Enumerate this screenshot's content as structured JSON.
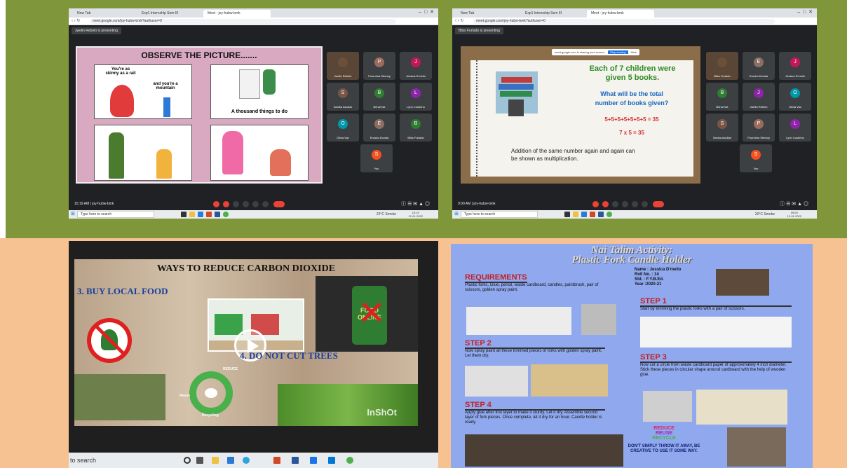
{
  "screen1": {
    "tabs": [
      "New Tab",
      "Exp1 Internship Sem III",
      "Meet - joy-hubw-bmk"
    ],
    "url": "meet.google.com/joy-hubw-bmk?authuser=0",
    "presenting": "Jwelin Rebelo is presenting",
    "slide_title": "OBSERVE THE PICTURE.......",
    "cell1_text_a": "You're as skinny as a rail",
    "cell1_text_b": "and you're a mountain",
    "cell2_text": "A thousand things to do",
    "participants": [
      {
        "name": "Jwelin Rebelo",
        "initial": "",
        "color": "#6a4f3a"
      },
      {
        "name": "Poornima Shenoy",
        "initial": "P",
        "color": "#9c6b5c"
      },
      {
        "name": "Jessica D'mello",
        "initial": "J",
        "color": "#c2185b"
      },
      {
        "name": "Sanika Asolkar",
        "initial": "S",
        "color": "#795548"
      },
      {
        "name": "Brinal NA",
        "initial": "B",
        "color": "#2e7d32"
      },
      {
        "name": "Lynn Coutinho",
        "initial": "L",
        "color": "#8e24aa"
      },
      {
        "name": "Olivia Vaz",
        "initial": "O",
        "color": "#0097a7"
      },
      {
        "name": "Erusha Dcosta",
        "initial": "E",
        "color": "#8d6e63"
      },
      {
        "name": "Bliss Furtado",
        "initial": "B",
        "color": "#2e7d32"
      },
      {
        "name": "You",
        "initial": "S",
        "color": "#f4511e"
      }
    ],
    "meeting_info": "10:19 AM | joy-hubw-bmk",
    "taskbar_search": "Type here to search",
    "weather": "22°C Smoke",
    "clock_time": "10:19",
    "clock_date": "12-01-2022"
  },
  "screen2": {
    "tabs": [
      "New Tab",
      "Exp1 Internship Sem III",
      "Meet - joy-hubw-bmk"
    ],
    "url": "meet.google.com/joy-hubw-bmk?authuser=0",
    "presenting": "Bliss Furtado is presenting",
    "banner_text": "meet.google.com is sharing your screen",
    "banner_btn1": "Stop sharing",
    "banner_btn2": "Hide",
    "line1": "Each of 7 children were",
    "line2": "given 5 books.",
    "question1": "What will be the total",
    "question2": "number of books given?",
    "sum": "5+5+5+5+5+5+5 = 35",
    "product": "7 x 5 = 35",
    "footer1": "Addition of the same number again and again can",
    "footer2": "be shown as multiplication.",
    "participants": [
      {
        "name": "Bliss Furtado",
        "initial": "",
        "color": "#6a4f3a"
      },
      {
        "name": "Erusha Dcosta",
        "initial": "E",
        "color": "#8d6e63"
      },
      {
        "name": "Jessica D'mello",
        "initial": "J",
        "color": "#c2185b"
      },
      {
        "name": "Brinal NA",
        "initial": "B",
        "color": "#2e7d32"
      },
      {
        "name": "Jwelin Rebelo",
        "initial": "J",
        "color": "#8e24aa"
      },
      {
        "name": "Olivia Vaz",
        "initial": "O",
        "color": "#0097a7"
      },
      {
        "name": "Sanika Asolkar",
        "initial": "S",
        "color": "#795548"
      },
      {
        "name": "Poornima Shenoy",
        "initial": "P",
        "color": "#9c6b5c"
      },
      {
        "name": "Lynn Coutinho",
        "initial": "L",
        "color": "#8e24aa"
      },
      {
        "name": "You",
        "initial": "S",
        "color": "#f4511e"
      }
    ],
    "meeting_info": "9:00 AM | joy-hubw-bmk",
    "taskbar_search": "Type here to search",
    "weather": "20°C Smoke",
    "clock_time": "09:00",
    "clock_date": "12-01-2022"
  },
  "screen3": {
    "title": "WAYS TO REDUCE CARBON DIOXIDE",
    "point3": "3. BUY LOCAL FOOD",
    "point4": "4. DO NOT CUT TREES",
    "food_text": "FOOD ONLINE",
    "reduce": "REDUCE",
    "reuse": "Reuse",
    "recycling": "Recycling",
    "watermark": "InShOt",
    "taskbar_search": "to search"
  },
  "screen4": {
    "title1": "Nai Talim Activity:",
    "title2": "Plastic Fork Candle Holder",
    "name_label": "Name",
    "name_value": ": Jessica D'mello",
    "roll_label": "Roll No.",
    "roll_value": ": 14",
    "std_label": "Std.",
    "std_value": ": F.Y.B.Ed.",
    "year_label": "Year",
    "year_value": ":2020-21",
    "requirements_head": "REQUIREMENTS",
    "requirements_text": "Plastic forks, Glue, pencil, waste cardboard, candles, paintbrush, pair of scissors, golden spray paint.",
    "step1_head": "STEP 1",
    "step1_text": "Start by trimming the plastic forks with a pair of scissors.",
    "step2_head": "STEP 2",
    "step2_text": "Now spray paint all these trimmed pieces of forks with golden spray paint. Let them dry.",
    "step3_head": "STEP 3",
    "step3_text": "Now cut a circle from waste cardboard paper of approximately 4 inch diameter. Stick these pieces in circular shape around cardboard with the help of wooden glue.",
    "step4_head": "STEP 4",
    "step4_text": "Apply glue after first layer to make it sturdy. Let it dry. Assemble second layer of fork pieces. Once complete, let it dry for an hour. Candle holder is ready.",
    "badge1": "REDUCE",
    "badge2": "REUSE",
    "badge3": "RECYCLE",
    "closing": "DON'T SIMPLY THROW IT AWAY, BE CREATIVE TO USE IT SOME WAY."
  }
}
